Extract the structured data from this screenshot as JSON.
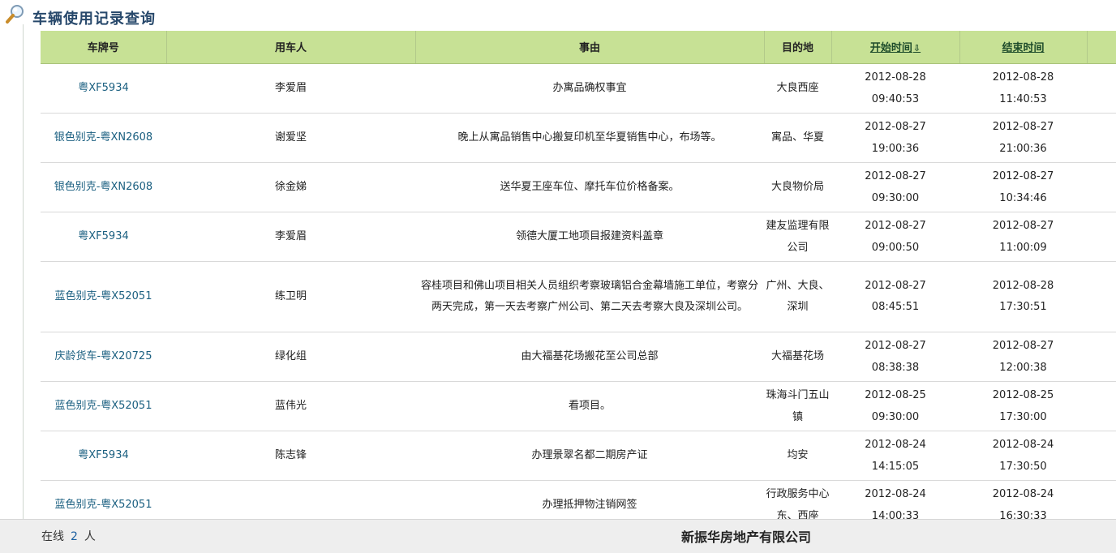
{
  "title": "车辆使用记录查询",
  "table": {
    "headers": {
      "plate": "车牌号",
      "user": "用车人",
      "reason": "事由",
      "destination": "目的地",
      "start_time": "开始时间",
      "end_time": "结束时间"
    },
    "sort_indicator": "⇩",
    "rows": [
      {
        "plate": "粤XF5934",
        "user": "李爱眉",
        "reason": "办寓品确权事宜",
        "destination": "大良西座",
        "start_date": "2012-08-28",
        "start_clock": "09:40:53",
        "end_date": "2012-08-28",
        "end_clock": "11:40:53"
      },
      {
        "plate": "银色别克-粤XN2608",
        "user": "谢爱坚",
        "reason": "晚上从寓品销售中心搬复印机至华夏销售中心，布场等。",
        "destination": "寓品、华夏",
        "start_date": "2012-08-27",
        "start_clock": "19:00:36",
        "end_date": "2012-08-27",
        "end_clock": "21:00:36"
      },
      {
        "plate": "银色别克-粤XN2608",
        "user": "徐金娣",
        "reason": "送华夏王座车位、摩托车位价格备案。",
        "destination": "大良物价局",
        "start_date": "2012-08-27",
        "start_clock": "09:30:00",
        "end_date": "2012-08-27",
        "end_clock": "10:34:46"
      },
      {
        "plate": "粤XF5934",
        "user": "李爱眉",
        "reason": "领德大厦工地项目报建资料盖章",
        "destination": "建友监理有限公司",
        "start_date": "2012-08-27",
        "start_clock": "09:00:50",
        "end_date": "2012-08-27",
        "end_clock": "11:00:09"
      },
      {
        "plate": "蓝色别克-粤X52051",
        "user": "练卫明",
        "reason": "容桂项目和佛山项目相关人员组织考察玻璃铝合金幕墙施工单位，考察分两天完成，第一天去考察广州公司、第二天去考察大良及深圳公司。",
        "destination": "广州、大良、深圳",
        "start_date": "2012-08-27",
        "start_clock": "08:45:51",
        "end_date": "2012-08-28",
        "end_clock": "17:30:51"
      },
      {
        "plate": "庆龄货车-粤X20725",
        "user": "绿化组",
        "reason": "由大福基花场搬花至公司总部",
        "destination": "大福基花场",
        "start_date": "2012-08-27",
        "start_clock": "08:38:38",
        "end_date": "2012-08-27",
        "end_clock": "12:00:38"
      },
      {
        "plate": "蓝色别克-粤X52051",
        "user": "蓝伟光",
        "reason": "看项目。",
        "destination": "珠海斗门五山镇",
        "start_date": "2012-08-25",
        "start_clock": "09:30:00",
        "end_date": "2012-08-25",
        "end_clock": "17:30:00"
      },
      {
        "plate": "粤XF5934",
        "user": "陈志锋",
        "reason": "办理景翠名都二期房产证",
        "destination": "均安",
        "start_date": "2012-08-24",
        "start_clock": "14:15:05",
        "end_date": "2012-08-24",
        "end_clock": "17:30:50"
      },
      {
        "plate": "蓝色别克-粤X52051",
        "user": "",
        "reason": "办理抵押物注销网签",
        "destination": "行政服务中心东、西座",
        "start_date": "2012-08-24",
        "start_clock": "14:00:33",
        "end_date": "2012-08-24",
        "end_clock": "16:30:33"
      }
    ]
  },
  "footer": {
    "online_prefix": "在线",
    "online_count": "2",
    "online_suffix": "人",
    "company": "新振华房地产有限公司"
  },
  "icons": {
    "title_icon": "magnifier-icon"
  }
}
